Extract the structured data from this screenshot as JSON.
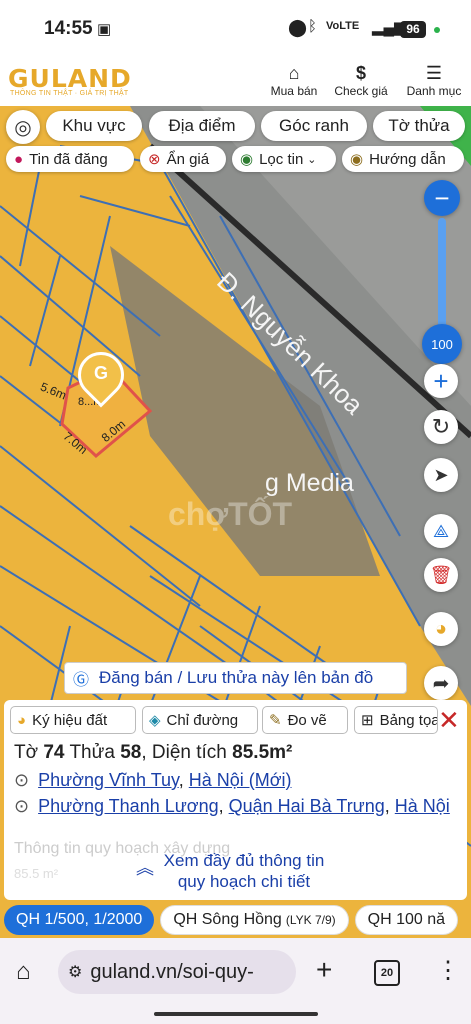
{
  "status_bar": {
    "time": "14:55",
    "battery": "96"
  },
  "header": {
    "logo": "GULAND",
    "tagline": "THÔNG TIN THẬT · GIÁ TRỊ THẬT",
    "nav": [
      {
        "label": "Mua bán",
        "icon": "house-icon"
      },
      {
        "label": "Check giá",
        "icon": "dollar-icon"
      },
      {
        "label": "Danh mục",
        "icon": "menu-icon"
      }
    ]
  },
  "map": {
    "top_filters": [
      "Khu vực",
      "Địa điểm",
      "Góc ranh",
      "Tờ thửa"
    ],
    "sub_filters": [
      "Tin đã đăng",
      "Ẩn giá",
      "Lọc tin",
      "Hướng dẫn"
    ],
    "street_label": "Đ. Nguyễn Khoa",
    "poi_label": "g Media",
    "watermark": "chợTỐT",
    "zoom_value": "100",
    "plot": {
      "edge_1": "5.6m",
      "edge_2": "8.0m",
      "edge_3": "7.0m",
      "edge_4": "8.0m",
      "center": "8...m²"
    },
    "save_banner": "Đăng bán / Lưu thửa này lên bản đồ"
  },
  "card": {
    "tools": [
      "Ký hiệu đất",
      "Chỉ đường",
      "Đo vẽ",
      "Bảng tọa"
    ],
    "to_label": "Tờ",
    "to_value": "74",
    "thua_label": "Thửa",
    "thua_value": "58",
    "area_label": "Diện tích",
    "area_value": "85.5m²",
    "address_new": [
      "Phường Vĩnh Tuy",
      "Hà Nội (Mới)"
    ],
    "address_old": [
      "Phường Thanh Lương",
      "Quận Hai Bà Trưng",
      "Hà Nội"
    ],
    "faded_title": "Thông tin quy hoạch xây dựng",
    "faded_value": "85.5 m²",
    "more_line1": "Xem đầy đủ thông tin",
    "more_line2": "quy hoạch chi tiết"
  },
  "bottom_tabs": [
    {
      "label": "QH 1/500, 1/2000",
      "sub": ""
    },
    {
      "label": "QH Sông Hồng",
      "sub": "(LYK 7/9)"
    },
    {
      "label": "QH 100 nă",
      "sub": ""
    }
  ],
  "browser": {
    "url": "guland.vn/soi-quy-",
    "tabs_count": "20"
  },
  "colors": {
    "accent": "#1a3fa8",
    "brand": "#e6a82a",
    "land": "#ecb43d",
    "plot_line": "#3d6fb5"
  }
}
